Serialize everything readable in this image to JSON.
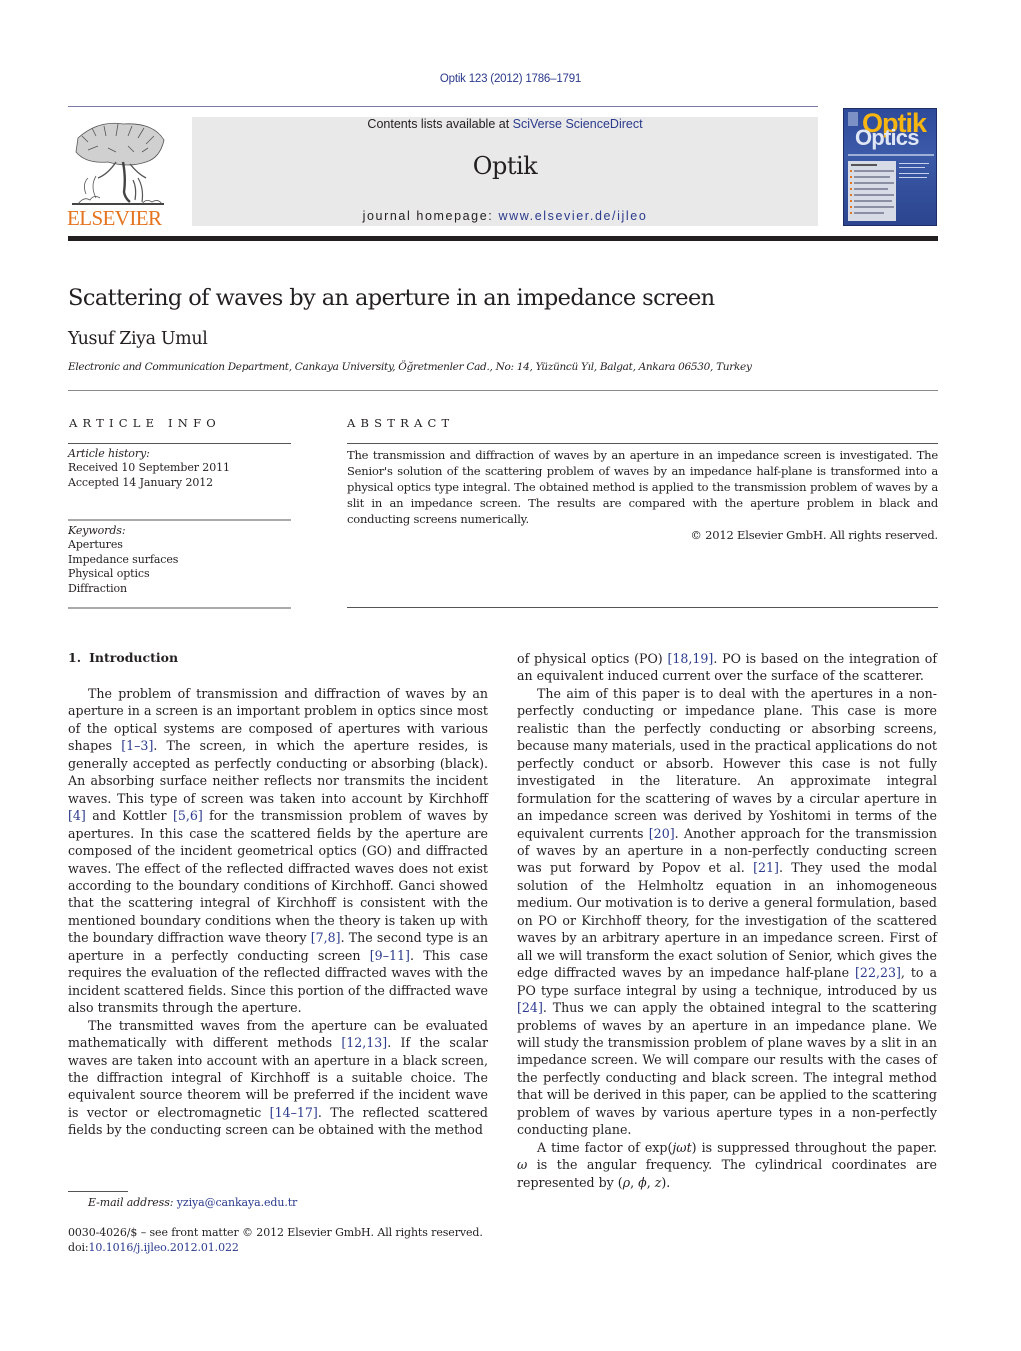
{
  "running_header": "Optik 123 (2012) 1786–1791",
  "masthead": {
    "publisher_wordmark": "ELSEVIER",
    "contents_prefix": "Contents lists available at ",
    "contents_link": "SciVerse ScienceDirect",
    "journal_name": "Optik",
    "homepage_prefix": "journal homepage: ",
    "homepage_link": "www.elsevier.de/ijleo",
    "cover_title_top": "Optik",
    "cover_title_bottom": "Optics"
  },
  "colors": {
    "link": "#2b3a8c",
    "elsevier_orange": "#e4741f",
    "masthead_gray": "#e9e9e9",
    "cover_blue": "#2e4a9a",
    "cover_yellow": "#f6b511"
  },
  "article": {
    "title": "Scattering of waves by an aperture in an impedance screen",
    "author": "Yusuf Ziya Umul",
    "affiliation": "Electronic and Communication Department, Cankaya University, Öğretmenler Cad., No: 14, Yüzüncü Yıl, Balgat, Ankara 06530, Turkey"
  },
  "article_info": {
    "heading": "ARTICLE INFO",
    "history_label": "Article history:",
    "received": "Received 10 September 2011",
    "accepted": "Accepted 14 January 2012",
    "keywords_label": "Keywords:",
    "keywords": [
      "Apertures",
      "Impedance surfaces",
      "Physical optics",
      "Diffraction"
    ]
  },
  "abstract": {
    "heading": "ABSTRACT",
    "text": "The transmission and diffraction of waves by an aperture in an impedance screen is investigated. The Senior's solution of the scattering problem of waves by an impedance half-plane is transformed into a physical optics type integral. The obtained method is applied to the transmission problem of waves by a slit in an impedance screen. The results are compared with the aperture problem in black and conducting screens numerically.",
    "copyright": "© 2012 Elsevier GmbH. All rights reserved."
  },
  "section": {
    "number": "1.",
    "title": "Introduction"
  },
  "body": {
    "p1": [
      {
        "t": "The problem of transmission and diffraction of waves by an aperture in a screen is an important problem in optics since most of the optical systems are composed of apertures with various shapes "
      },
      {
        "r": "[1–3]"
      },
      {
        "t": ". The screen, in which the aperture resides, is generally accepted as perfectly conducting or absorbing (black). An absorbing surface neither reflects nor transmits the incident waves. This type of screen was taken into account by Kirchhoff "
      },
      {
        "r": "[4]"
      },
      {
        "t": " and Kottler "
      },
      {
        "r": "[5,6]"
      },
      {
        "t": " for the transmission problem of waves by apertures. In this case the scattered fields by the aperture are composed of the incident geometrical optics (GO) and diffracted waves. The effect of the reflected diffracted waves does not exist according to the boundary conditions of Kirchhoff. Ganci showed that the scattering integral of Kirchhoff is consistent with the mentioned boundary conditions when the theory is taken up with the boundary diffraction wave theory "
      },
      {
        "r": "[7,8]"
      },
      {
        "t": ". The second type is an aperture in a perfectly conducting screen "
      },
      {
        "r": "[9–11]"
      },
      {
        "t": ". This case requires the evaluation of the reflected diffracted waves with the incident scattered fields. Since this portion of the diffracted wave also transmits through the aperture."
      }
    ],
    "p2": [
      {
        "t": "The transmitted waves from the aperture can be evaluated mathematically with different methods "
      },
      {
        "r": "[12,13]"
      },
      {
        "t": ". If the scalar waves are taken into account with an aperture in a black screen, the diffraction integral of Kirchhoff is a suitable choice. The equivalent source theorem will be preferred if the incident wave is vector or electromagnetic "
      },
      {
        "r": "[14–17]"
      },
      {
        "t": ". The reflected scattered fields by the conducting screen can be obtained with the method"
      }
    ],
    "p2_cont": [
      {
        "t": "of physical optics (PO) "
      },
      {
        "r": "[18,19]"
      },
      {
        "t": ". PO is based on the integration of an equivalent induced current over the surface of the scatterer."
      }
    ],
    "p3": [
      {
        "t": "The aim of this paper is to deal with the apertures in a non-perfectly conducting or impedance plane. This case is more realistic than the perfectly conducting or absorbing screens, because many materials, used in the practical applications do not perfectly conduct or absorb. However this case is not fully investigated in the literature. An approximate integral formulation for the scattering of waves by a circular aperture in an impedance screen was derived by Yoshitomi in terms of the equivalent currents "
      },
      {
        "r": "[20]"
      },
      {
        "t": ". Another approach for the transmission of waves by an aperture in a non-perfectly conducting screen was put forward by Popov et al. "
      },
      {
        "r": "[21]"
      },
      {
        "t": ". They used the modal solution of the Helmholtz equation in an inhomogeneous medium. Our motivation is to derive a general formulation, based on PO or Kirchhoff theory, for the investigation of the scattered waves by an arbitrary aperture in an impedance screen. First of all we will transform the exact solution of Senior, which gives the edge diffracted waves by an impedance half-plane "
      },
      {
        "r": "[22,23]"
      },
      {
        "t": ", to a PO type surface integral by using a technique, introduced by us "
      },
      {
        "r": "[24]"
      },
      {
        "t": ". Thus we can apply the obtained integral to the scattering problems of waves by an aperture in an impedance plane. We will study the transmission problem of plane waves by a slit in an impedance screen. We will compare our results with the cases of the perfectly conducting and black screen. The integral method that will be derived in this paper, can be applied to the scattering problem of waves by various aperture types in a non-perfectly conducting plane."
      }
    ],
    "p4": [
      {
        "t": "A time factor of exp("
      },
      {
        "m": "jωt"
      },
      {
        "t": ") is suppressed throughout the paper. "
      },
      {
        "m": "ω"
      },
      {
        "t": " is the angular frequency. The cylindrical coordinates are represented by ("
      },
      {
        "m": "ρ"
      },
      {
        "t": ", "
      },
      {
        "m": "ϕ"
      },
      {
        "t": ", "
      },
      {
        "m": "z"
      },
      {
        "t": ")."
      }
    ]
  },
  "footnote": {
    "label": "E-mail address: ",
    "email": "yziya@cankaya.edu.tr"
  },
  "footer": {
    "issn_line": "0030-4026/$ – see front matter © 2012 Elsevier GmbH. All rights reserved.",
    "doi_prefix": "doi:",
    "doi": "10.1016/j.ijleo.2012.01.022"
  }
}
